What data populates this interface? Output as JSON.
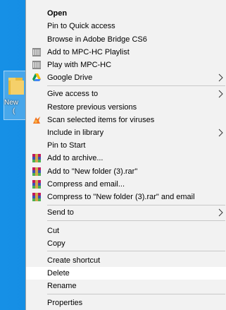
{
  "desktop": {
    "folder_caption_line1": "New",
    "folder_caption_line2": "(",
    "background_color": "#0f7fd6"
  },
  "context_menu": {
    "items": [
      {
        "label": "Open"
      },
      {
        "label": "Pin to Quick access"
      },
      {
        "label": "Browse in Adobe Bridge CS6"
      },
      {
        "label": "Add to MPC-HC Playlist",
        "icon": "mpc-hc-icon"
      },
      {
        "label": "Play with MPC-HC",
        "icon": "mpc-hc-icon"
      },
      {
        "label": "Google Drive",
        "icon": "google-drive-icon"
      },
      {
        "label": "Give access to"
      },
      {
        "label": "Restore previous versions"
      },
      {
        "label": "Scan selected items for viruses",
        "icon": "antivirus-icon"
      },
      {
        "label": "Include in library"
      },
      {
        "label": "Pin to Start"
      },
      {
        "label": "Add to archive...",
        "icon": "winrar-icon"
      },
      {
        "label": "Add to \"New folder (3).rar\"",
        "icon": "winrar-icon"
      },
      {
        "label": "Compress and email...",
        "icon": "winrar-icon"
      },
      {
        "label": "Compress to \"New folder (3).rar\" and email",
        "icon": "winrar-icon"
      },
      {
        "label": "Send to"
      },
      {
        "label": "Cut"
      },
      {
        "label": "Copy"
      },
      {
        "label": "Create shortcut"
      },
      {
        "label": "Delete",
        "highlighted": true
      },
      {
        "label": "Rename"
      },
      {
        "label": "Properties"
      }
    ]
  },
  "colors": {
    "menu_background": "#f2f2f2",
    "hover_background": "#ffffff",
    "separator": "#c8c8c8"
  }
}
